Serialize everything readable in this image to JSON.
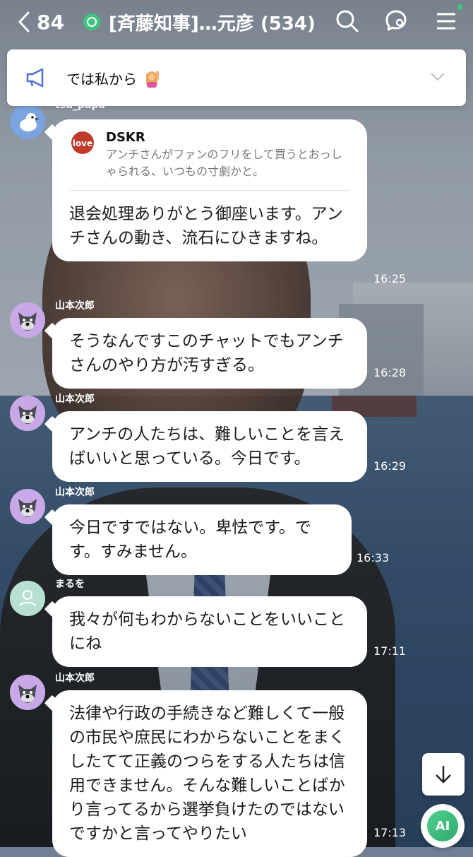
{
  "header": {
    "back_count": "84",
    "title": "[斉藤知事]…元彦 (534)",
    "icons": [
      "back-chevron-icon",
      "search-icon",
      "chat-bubbles-icon",
      "menu-icon"
    ]
  },
  "announcement": {
    "text": "では私から",
    "icon": "megaphone-icon"
  },
  "messages": [
    {
      "sender": "tsu_papa",
      "avatar": "bird-avatar",
      "reply": {
        "name": "DSKR",
        "text": "アンチさんがファンのフリをして買うとおっしゃられる、いつもの寸劇かと。"
      },
      "text": "退会処理ありがとう御座います。アンチさんの動き、流石にひきますね。",
      "time": "16:25"
    },
    {
      "sender": "山本次郎",
      "avatar": "dog-avatar",
      "text": "そうなんですこのチャットでもアンチさんのやり方が汚すぎる。",
      "time": "16:28"
    },
    {
      "sender": "山本次郎",
      "avatar": "dog-avatar",
      "text": "アンチの人たちは、難しいことを言えばいいと思っている。今日です。",
      "time": "16:29"
    },
    {
      "sender": "山本次郎",
      "avatar": "dog-avatar",
      "text": "今日ですではない。卑怯です。です。すみません。",
      "time": "16:33"
    },
    {
      "sender": "まるを",
      "avatar": "default-person-avatar",
      "text": "我々が何もわからないことをいいことにね",
      "time": "17:11"
    },
    {
      "sender": "山本次郎",
      "avatar": "dog-avatar",
      "text": "法律や行政の手続きなど難しくて一般の市民や庶民にわからないことをまくしたてて正義のつらをする人たちは信用できません。そんな難しいことばかり言ってるから選挙負けたのではないですかと言ってやりたい",
      "time": "17:13"
    }
  ],
  "floating": {
    "scroll_down_icon": "arrow-down-icon",
    "ai_label": "AI"
  },
  "colors": {
    "accent_green": "#3fc47e",
    "bubble": "#ffffff"
  }
}
